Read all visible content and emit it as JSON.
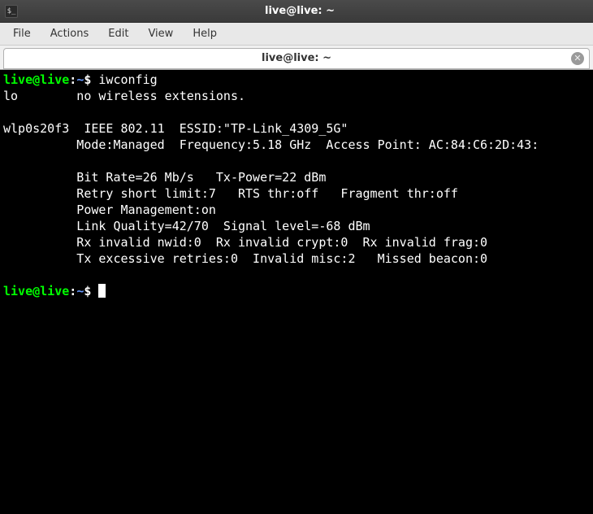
{
  "window": {
    "title": "live@live: ~"
  },
  "menubar": {
    "file": "File",
    "actions": "Actions",
    "edit": "Edit",
    "view": "View",
    "help": "Help"
  },
  "tab": {
    "label": "live@live: ~"
  },
  "prompt": {
    "user_host": "live@live",
    "sep1": ":",
    "path": "~",
    "sep2": "$ "
  },
  "terminal": {
    "cmd1": "iwconfig",
    "line_lo": "lo        no wireless extensions.",
    "blank": "",
    "line_if1": "wlp0s20f3  IEEE 802.11  ESSID:\"TP-Link_4309_5G\"",
    "line_if2": "          Mode:Managed  Frequency:5.18 GHz  Access Point: AC:84:C6:2D:43:",
    "line_if3": "          Bit Rate=26 Mb/s   Tx-Power=22 dBm",
    "line_if4": "          Retry short limit:7   RTS thr:off   Fragment thr:off",
    "line_if5": "          Power Management:on",
    "line_if6": "          Link Quality=42/70  Signal level=-68 dBm",
    "line_if7": "          Rx invalid nwid:0  Rx invalid crypt:0  Rx invalid frag:0",
    "line_if8": "          Tx excessive retries:0  Invalid misc:2   Missed beacon:0"
  }
}
